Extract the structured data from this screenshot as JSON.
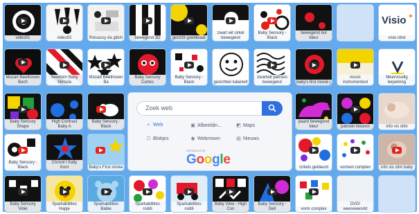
{
  "tiles": {
    "r1": [
      "video01",
      "video02",
      "Rotsassy da glitch",
      "bewegend 3D",
      "gezicht goeldwaar",
      "zwart wit cirkel bewegend",
      "Baby Sensory - Black",
      "bewegend bol kleur",
      "",
      "visio idnd"
    ],
    "r2": [
      "Mozart Beethoven Bach",
      "Newborn Baby Stimula",
      "Mozart Beethoven Ba",
      "Baby Sensory Cartes",
      "Baby Sensory - Black",
      "gezichten kalanwit",
      "zwartwit patroon bewegend",
      "baby's first movie (",
      "music instrumentool",
      "Meervoudig beperking"
    ],
    "r3": [
      "Baby Sensory Shape",
      "High Contrast Baby A",
      "Baby Sensory - Black",
      "paard bewegend kleur",
      "patroon kleuren",
      "info vis stim"
    ],
    "r4": [
      "Baby Sensory - Black",
      "Chrisnl I Kally Koni",
      "Baby's First stroke",
      "cirkels gekleurd",
      "vormen complex",
      "info vis stim baby"
    ],
    "r5": [
      "Baby Sensory Videi",
      "Sparkabilities Hapje",
      "Sparkabilities Babie",
      "Sparkabilities roddi",
      "Sparkabilities roddi",
      "Baby View - High Con",
      "Baby Sensory - Dell",
      "vorm complex",
      "DVD! weeseeworld",
      ""
    ]
  },
  "brand_tile": {
    "logo_text": "Visio"
  },
  "tile5_10_caption": "",
  "search": {
    "placeholder": "Zoek web",
    "options": [
      {
        "label": "Web",
        "icon": "search-icon",
        "active": true
      },
      {
        "label": "Afbeeldin...",
        "icon": "image-icon",
        "active": false
      },
      {
        "label": "Maps",
        "icon": "map-icon",
        "active": false
      },
      {
        "label": "Blokjes",
        "icon": "blocks-icon",
        "active": false
      },
      {
        "label": "Webmixen",
        "icon": "radio-icon",
        "active": false
      },
      {
        "label": "Nieuws",
        "icon": "news-icon",
        "active": false
      }
    ],
    "enhanced_by": "enhanced by",
    "google_letters": [
      "G",
      "o",
      "o",
      "g",
      "l",
      "e"
    ]
  },
  "colors": {
    "grid_bg": "#63a9ec",
    "accent": "#2f6fdf",
    "tile_border": "#9cc9ee"
  }
}
